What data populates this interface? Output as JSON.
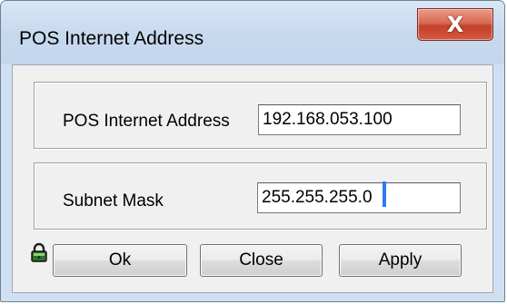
{
  "window": {
    "title": "POS Internet Address",
    "close_glyph": "X",
    "close_icon": "close-icon"
  },
  "fields": {
    "ip": {
      "label": "POS Internet Address",
      "value": "192.168.053.100"
    },
    "subnet": {
      "label": "Subnet Mask",
      "value": "255.255.255.0"
    }
  },
  "buttons": {
    "ok": "Ok",
    "close": "Close",
    "apply": "Apply"
  },
  "icons": {
    "lock": "lock-icon"
  },
  "colors": {
    "title_bar": "#c7d9ee",
    "close_button": "#c4402a",
    "client_bg": "#f0f0f0",
    "caret": "#2a7bf6"
  }
}
